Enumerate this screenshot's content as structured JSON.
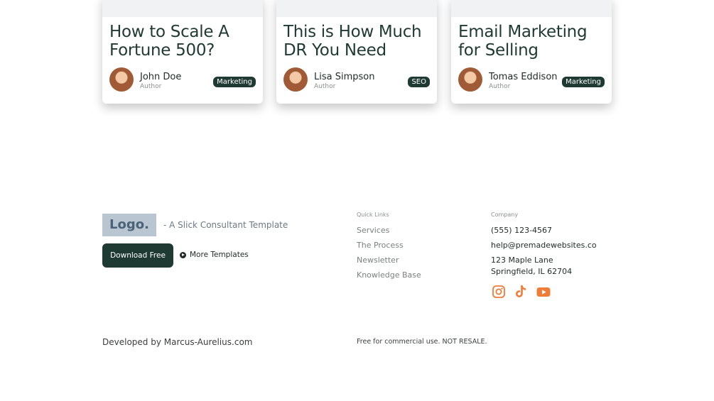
{
  "cards": [
    {
      "title": "How to Scale A Fortune 500?",
      "author": "John Doe",
      "role": "Author",
      "tag": "Marketing"
    },
    {
      "title": "This is How Much DR You Need",
      "author": "Lisa Simpson",
      "role": "Author",
      "tag": "SEO"
    },
    {
      "title": "Email Marketing for Selling",
      "author": "Tomas Eddison",
      "role": "Author",
      "tag": "Marketing"
    }
  ],
  "footer": {
    "logo": "Logo.",
    "tagline": "- A Slick Consultant Template",
    "download_label": "Download Free",
    "more_label": "More Templates",
    "quick_links_heading": "Quick Links",
    "quick_links": [
      "Services",
      "The Process",
      "Newsletter",
      "Knowledge Base"
    ],
    "company_heading": "Company",
    "phone": "(555) 123-4567",
    "email": "help@premadewebsites.co",
    "address_line1": "123 Maple Lane",
    "address_line2": "Springfield, IL 62704",
    "social_icons": [
      "instagram-icon",
      "tiktok-icon",
      "youtube-icon"
    ],
    "developed_by": "Developed by Marcus-Aurelius.com",
    "license": "Free for commercial use. NOT RESALE."
  },
  "colors": {
    "dark_green": "#1f3a32",
    "social_orange": "#f07c3a",
    "logo_bg": "#b9c6d1"
  }
}
